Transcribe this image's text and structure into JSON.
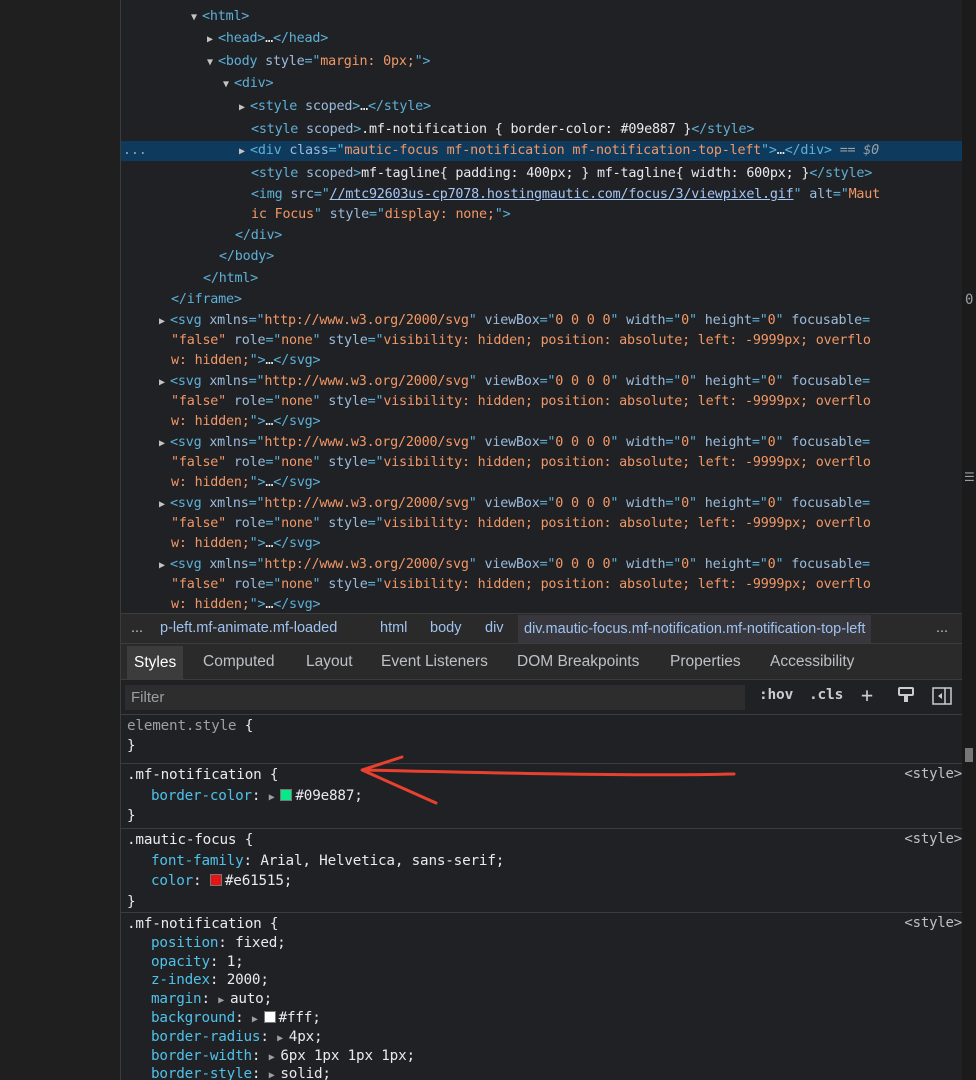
{
  "dom": {
    "lines": [
      {
        "indent": 70,
        "tri": "▼",
        "parts": [
          [
            "tag",
            "<html>"
          ]
        ]
      },
      {
        "indent": 86,
        "tri": "▶",
        "parts": [
          [
            "tag",
            "<head>"
          ],
          [
            "txt",
            "…"
          ],
          [
            "tag",
            "</head>"
          ]
        ]
      },
      {
        "indent": 86,
        "tri": "▼",
        "parts": [
          [
            "tag",
            "<body"
          ],
          [
            "attr",
            " style"
          ],
          [
            "tag",
            "=\""
          ],
          [
            "val",
            "margin: 0px;"
          ],
          [
            "tag",
            "\">"
          ]
        ]
      },
      {
        "indent": 102,
        "tri": "▼",
        "parts": [
          [
            "tag",
            "<div>"
          ]
        ]
      },
      {
        "indent": 118,
        "tri": "▶",
        "parts": [
          [
            "tag",
            "<style"
          ],
          [
            "attr",
            " scoped"
          ],
          [
            "tag",
            ">"
          ],
          [
            "txt",
            "…"
          ],
          [
            "tag",
            "</style>"
          ]
        ]
      },
      {
        "indent": 130,
        "tri": "",
        "parts": [
          [
            "tag",
            "<style"
          ],
          [
            "attr",
            " scoped"
          ],
          [
            "tag",
            ">"
          ],
          [
            "txt",
            ".mf-notification { border-color: #09e887 }"
          ],
          [
            "tag",
            "</style>"
          ]
        ]
      },
      {
        "indent": 118,
        "tri": "▶",
        "selected": true,
        "parts": [
          [
            "tag",
            "<div"
          ],
          [
            "attr",
            " class"
          ],
          [
            "tag",
            "=\""
          ],
          [
            "val",
            "mautic-focus mf-notification mf-notification-top-left"
          ],
          [
            "tag",
            "\">"
          ],
          [
            "txt",
            "…"
          ],
          [
            "tag",
            "</div>"
          ],
          [
            "dollar",
            " == $0"
          ]
        ]
      },
      {
        "indent": 130,
        "tri": "",
        "parts": [
          [
            "tag",
            "<style"
          ],
          [
            "attr",
            " scoped"
          ],
          [
            "tag",
            ">"
          ],
          [
            "txt",
            "mf-tagline{ padding: 400px; } mf-tagline{ width: 600px; }"
          ],
          [
            "tag",
            "</style>"
          ]
        ]
      },
      {
        "indent": 130,
        "tri": "",
        "parts": [
          [
            "tag",
            "<img"
          ],
          [
            "attr",
            " src"
          ],
          [
            "tag",
            "=\""
          ],
          [
            "link",
            "//mtc92603us-cp7078.hostingmautic.com/focus/3/viewpixel.gif"
          ],
          [
            "tag",
            "\""
          ],
          [
            "attr",
            " alt"
          ],
          [
            "tag",
            "=\""
          ],
          [
            "val",
            "Maut"
          ]
        ]
      },
      {
        "indent": 130,
        "tri": "",
        "parts": [
          [
            "val",
            "ic Focus"
          ],
          [
            "tag",
            "\""
          ],
          [
            "attr",
            " style"
          ],
          [
            "tag",
            "=\""
          ],
          [
            "val",
            "display: none;"
          ],
          [
            "tag",
            "\">"
          ]
        ]
      },
      {
        "indent": 114,
        "tri": "",
        "parts": [
          [
            "tag",
            "</div>"
          ]
        ]
      },
      {
        "indent": 98,
        "tri": "",
        "parts": [
          [
            "tag",
            "</body>"
          ]
        ]
      },
      {
        "indent": 82,
        "tri": "",
        "parts": [
          [
            "tag",
            "</html>"
          ]
        ]
      },
      {
        "indent": 50,
        "tri": "",
        "parts": [
          [
            "tag",
            "</iframe>"
          ]
        ]
      },
      {
        "indent": 38,
        "tri": "▶",
        "parts": [
          [
            "tag",
            "<svg"
          ],
          [
            "attr",
            " xmlns"
          ],
          [
            "tag",
            "=\""
          ],
          [
            "val",
            "http://www.w3.org/2000/svg"
          ],
          [
            "tag",
            "\""
          ],
          [
            "attr",
            " viewBox"
          ],
          [
            "tag",
            "=\""
          ],
          [
            "val",
            "0 0 0 0"
          ],
          [
            "tag",
            "\""
          ],
          [
            "attr",
            " width"
          ],
          [
            "tag",
            "=\""
          ],
          [
            "val",
            "0"
          ],
          [
            "tag",
            "\""
          ],
          [
            "attr",
            " height"
          ],
          [
            "tag",
            "=\""
          ],
          [
            "val",
            "0"
          ],
          [
            "tag",
            "\""
          ],
          [
            "attr",
            " focusable"
          ],
          [
            "tag",
            "="
          ]
        ]
      },
      {
        "indent": 50,
        "tri": "",
        "parts": [
          [
            "val",
            "\"false\""
          ],
          [
            "attr",
            " role"
          ],
          [
            "tag",
            "=\""
          ],
          [
            "val",
            "none"
          ],
          [
            "tag",
            "\""
          ],
          [
            "attr",
            " style"
          ],
          [
            "tag",
            "=\""
          ],
          [
            "val",
            "visibility: hidden; position: absolute; left: -9999px; overflo"
          ]
        ]
      },
      {
        "indent": 50,
        "tri": "",
        "parts": [
          [
            "val",
            "w: hidden;"
          ],
          [
            "tag",
            "\">"
          ],
          [
            "txt",
            "…"
          ],
          [
            "tag",
            "</svg>"
          ]
        ]
      },
      {
        "indent": 38,
        "tri": "▶",
        "parts": [
          [
            "tag",
            "<svg"
          ],
          [
            "attr",
            " xmlns"
          ],
          [
            "tag",
            "=\""
          ],
          [
            "val",
            "http://www.w3.org/2000/svg"
          ],
          [
            "tag",
            "\""
          ],
          [
            "attr",
            " viewBox"
          ],
          [
            "tag",
            "=\""
          ],
          [
            "val",
            "0 0 0 0"
          ],
          [
            "tag",
            "\""
          ],
          [
            "attr",
            " width"
          ],
          [
            "tag",
            "=\""
          ],
          [
            "val",
            "0"
          ],
          [
            "tag",
            "\""
          ],
          [
            "attr",
            " height"
          ],
          [
            "tag",
            "=\""
          ],
          [
            "val",
            "0"
          ],
          [
            "tag",
            "\""
          ],
          [
            "attr",
            " focusable"
          ],
          [
            "tag",
            "="
          ]
        ]
      },
      {
        "indent": 50,
        "tri": "",
        "parts": [
          [
            "val",
            "\"false\""
          ],
          [
            "attr",
            " role"
          ],
          [
            "tag",
            "=\""
          ],
          [
            "val",
            "none"
          ],
          [
            "tag",
            "\""
          ],
          [
            "attr",
            " style"
          ],
          [
            "tag",
            "=\""
          ],
          [
            "val",
            "visibility: hidden; position: absolute; left: -9999px; overflo"
          ]
        ]
      },
      {
        "indent": 50,
        "tri": "",
        "parts": [
          [
            "val",
            "w: hidden;"
          ],
          [
            "tag",
            "\">"
          ],
          [
            "txt",
            "…"
          ],
          [
            "tag",
            "</svg>"
          ]
        ]
      },
      {
        "indent": 38,
        "tri": "▶",
        "parts": [
          [
            "tag",
            "<svg"
          ],
          [
            "attr",
            " xmlns"
          ],
          [
            "tag",
            "=\""
          ],
          [
            "val",
            "http://www.w3.org/2000/svg"
          ],
          [
            "tag",
            "\""
          ],
          [
            "attr",
            " viewBox"
          ],
          [
            "tag",
            "=\""
          ],
          [
            "val",
            "0 0 0 0"
          ],
          [
            "tag",
            "\""
          ],
          [
            "attr",
            " width"
          ],
          [
            "tag",
            "=\""
          ],
          [
            "val",
            "0"
          ],
          [
            "tag",
            "\""
          ],
          [
            "attr",
            " height"
          ],
          [
            "tag",
            "=\""
          ],
          [
            "val",
            "0"
          ],
          [
            "tag",
            "\""
          ],
          [
            "attr",
            " focusable"
          ],
          [
            "tag",
            "="
          ]
        ]
      },
      {
        "indent": 50,
        "tri": "",
        "parts": [
          [
            "val",
            "\"false\""
          ],
          [
            "attr",
            " role"
          ],
          [
            "tag",
            "=\""
          ],
          [
            "val",
            "none"
          ],
          [
            "tag",
            "\""
          ],
          [
            "attr",
            " style"
          ],
          [
            "tag",
            "=\""
          ],
          [
            "val",
            "visibility: hidden; position: absolute; left: -9999px; overflo"
          ]
        ]
      },
      {
        "indent": 50,
        "tri": "",
        "parts": [
          [
            "val",
            "w: hidden;"
          ],
          [
            "tag",
            "\">"
          ],
          [
            "txt",
            "…"
          ],
          [
            "tag",
            "</svg>"
          ]
        ]
      },
      {
        "indent": 38,
        "tri": "▶",
        "parts": [
          [
            "tag",
            "<svg"
          ],
          [
            "attr",
            " xmlns"
          ],
          [
            "tag",
            "=\""
          ],
          [
            "val",
            "http://www.w3.org/2000/svg"
          ],
          [
            "tag",
            "\""
          ],
          [
            "attr",
            " viewBox"
          ],
          [
            "tag",
            "=\""
          ],
          [
            "val",
            "0 0 0 0"
          ],
          [
            "tag",
            "\""
          ],
          [
            "attr",
            " width"
          ],
          [
            "tag",
            "=\""
          ],
          [
            "val",
            "0"
          ],
          [
            "tag",
            "\""
          ],
          [
            "attr",
            " height"
          ],
          [
            "tag",
            "=\""
          ],
          [
            "val",
            "0"
          ],
          [
            "tag",
            "\""
          ],
          [
            "attr",
            " focusable"
          ],
          [
            "tag",
            "="
          ]
        ]
      },
      {
        "indent": 50,
        "tri": "",
        "parts": [
          [
            "val",
            "\"false\""
          ],
          [
            "attr",
            " role"
          ],
          [
            "tag",
            "=\""
          ],
          [
            "val",
            "none"
          ],
          [
            "tag",
            "\""
          ],
          [
            "attr",
            " style"
          ],
          [
            "tag",
            "=\""
          ],
          [
            "val",
            "visibility: hidden; position: absolute; left: -9999px; overflo"
          ]
        ]
      },
      {
        "indent": 50,
        "tri": "",
        "parts": [
          [
            "val",
            "w: hidden;"
          ],
          [
            "tag",
            "\">"
          ],
          [
            "txt",
            "…"
          ],
          [
            "tag",
            "</svg>"
          ]
        ]
      },
      {
        "indent": 38,
        "tri": "▶",
        "parts": [
          [
            "tag",
            "<svg"
          ],
          [
            "attr",
            " xmlns"
          ],
          [
            "tag",
            "=\""
          ],
          [
            "val",
            "http://www.w3.org/2000/svg"
          ],
          [
            "tag",
            "\""
          ],
          [
            "attr",
            " viewBox"
          ],
          [
            "tag",
            "=\""
          ],
          [
            "val",
            "0 0 0 0"
          ],
          [
            "tag",
            "\""
          ],
          [
            "attr",
            " width"
          ],
          [
            "tag",
            "=\""
          ],
          [
            "val",
            "0"
          ],
          [
            "tag",
            "\""
          ],
          [
            "attr",
            " height"
          ],
          [
            "tag",
            "=\""
          ],
          [
            "val",
            "0"
          ],
          [
            "tag",
            "\""
          ],
          [
            "attr",
            " focusable"
          ],
          [
            "tag",
            "="
          ]
        ]
      },
      {
        "indent": 50,
        "tri": "",
        "parts": [
          [
            "val",
            "\"false\""
          ],
          [
            "attr",
            " role"
          ],
          [
            "tag",
            "=\""
          ],
          [
            "val",
            "none"
          ],
          [
            "tag",
            "\""
          ],
          [
            "attr",
            " style"
          ],
          [
            "tag",
            "=\""
          ],
          [
            "val",
            "visibility: hidden; position: absolute; left: -9999px; overflo"
          ]
        ]
      },
      {
        "indent": 50,
        "tri": "",
        "parts": [
          [
            "val",
            "w: hidden;"
          ],
          [
            "tag",
            "\">"
          ],
          [
            "txt",
            "…"
          ],
          [
            "tag",
            "</svg>"
          ]
        ]
      }
    ],
    "selected_marker": "...",
    "right_edge_glyph": "0"
  },
  "breadcrumb": {
    "more_left": "...",
    "items": [
      "p-left.mf-animate.mf-loaded",
      "html",
      "body",
      "div",
      "div.mautic-focus.mf-notification.mf-notification-top-left"
    ],
    "more_right": "..."
  },
  "tabs": [
    "Styles",
    "Computed",
    "Layout",
    "Event Listeners",
    "DOM Breakpoints",
    "Properties",
    "Accessibility"
  ],
  "filter": {
    "placeholder": "Filter",
    "hov": ":hov",
    "cls": ".cls",
    "plus": "+"
  },
  "styles": {
    "element_style": {
      "selector": "element.style",
      "open": "{",
      "close": "}"
    },
    "rules": [
      {
        "selector": ".mf-notification",
        "source": "<style>",
        "props": [
          {
            "name": "border-color",
            "value": "#09e887",
            "swatch": "#09e887",
            "expandable": true
          }
        ]
      },
      {
        "selector": ".mautic-focus",
        "source": "<style>",
        "props": [
          {
            "name": "font-family",
            "value": "Arial, Helvetica, sans-serif"
          },
          {
            "name": "color",
            "value": "#e61515",
            "swatch": "#e61515"
          }
        ]
      },
      {
        "selector": ".mf-notification",
        "source": "<style>",
        "props": [
          {
            "name": "position",
            "value": "fixed"
          },
          {
            "name": "opacity",
            "value": "1"
          },
          {
            "name": "z-index",
            "value": "2000"
          },
          {
            "name": "margin",
            "value": "auto",
            "expandable": true
          },
          {
            "name": "background",
            "value": "#fff",
            "swatch": "#ffffff",
            "expandable": true
          },
          {
            "name": "border-radius",
            "value": "4px",
            "expandable": true
          },
          {
            "name": "border-width",
            "value": "6px 1px 1px 1px",
            "expandable": true
          },
          {
            "name": "border-style",
            "value": "solid",
            "expandable": true
          }
        ]
      }
    ]
  },
  "annotation": {
    "color": "#e8412f"
  }
}
